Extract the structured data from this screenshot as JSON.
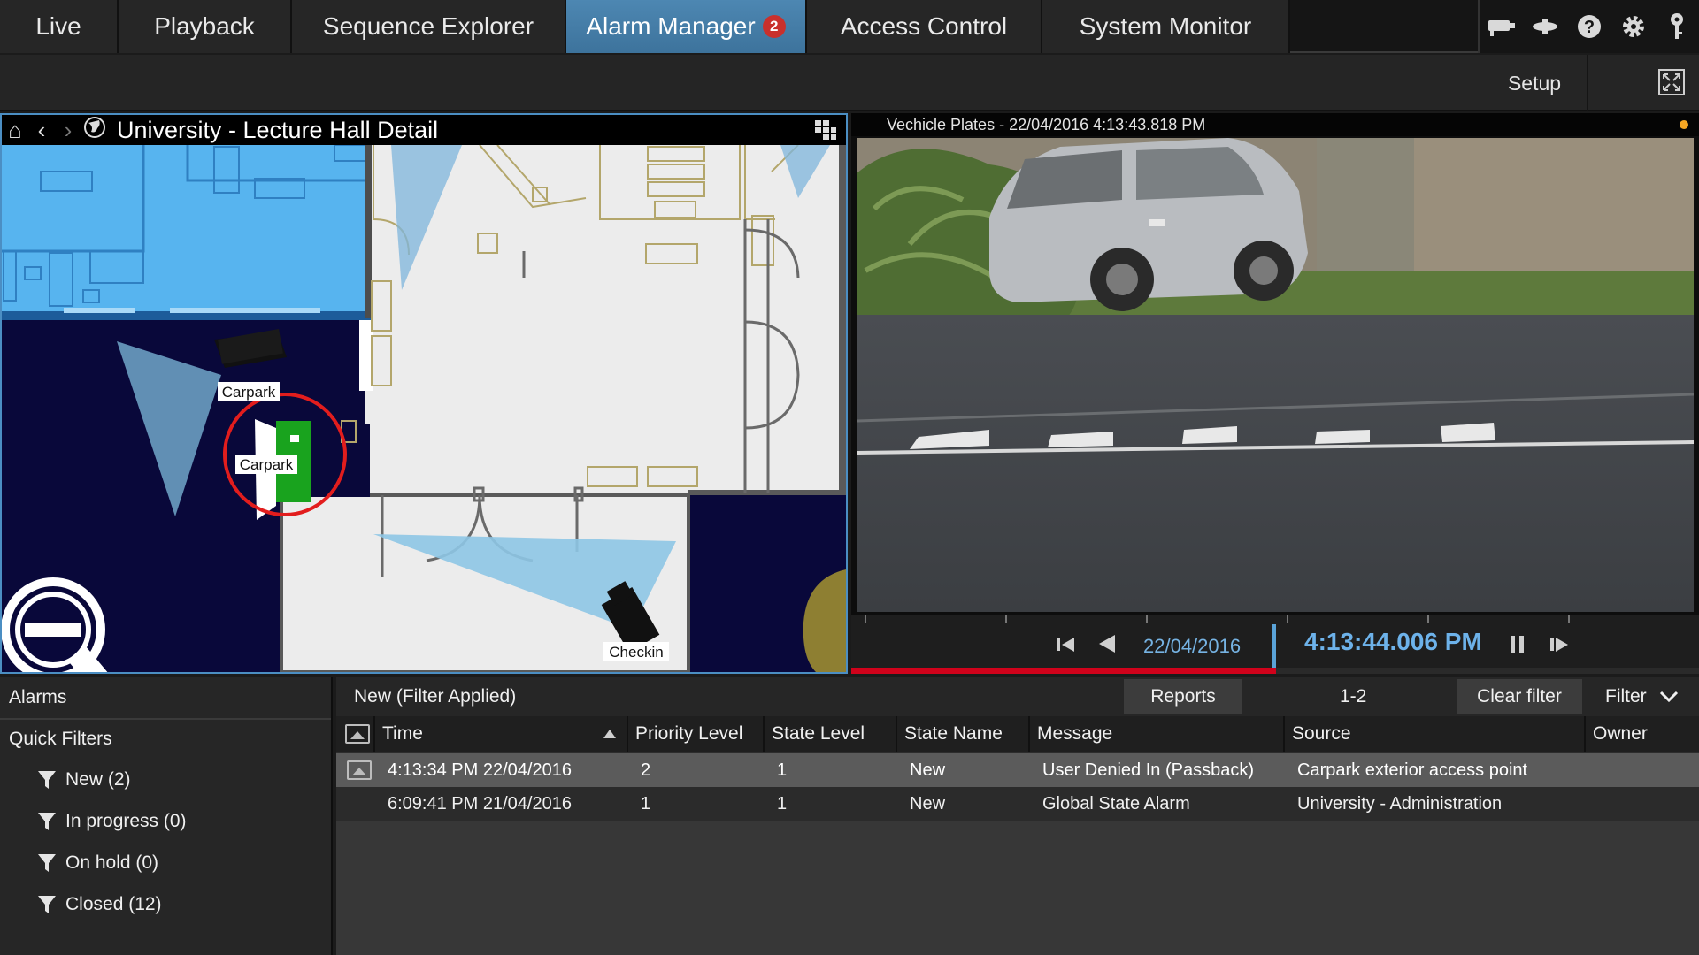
{
  "nav": {
    "tabs": [
      {
        "label": "Live"
      },
      {
        "label": "Playback"
      },
      {
        "label": "Sequence Explorer"
      },
      {
        "label": "Alarm Manager",
        "badge": "2",
        "active": true
      },
      {
        "label": "Access Control"
      },
      {
        "label": "System Monitor"
      }
    ],
    "icons": [
      "camera-icon",
      "device-icon",
      "help-icon",
      "gear-icon",
      "key-icon"
    ]
  },
  "toolbar": {
    "setup_label": "Setup"
  },
  "map": {
    "title": "University - Lecture Hall Detail",
    "labels": {
      "camera_carpark": "Carpark",
      "door_carpark": "Carpark",
      "camera_checkin": "Checkin"
    }
  },
  "video": {
    "title": "Vechicle Plates - 22/04/2016 4:13:43.818 PM",
    "date": "22/04/2016",
    "time": "4:13:44.006 PM",
    "progress": 0.5
  },
  "alarms": {
    "title": "Alarms",
    "quick_filters_title": "Quick Filters",
    "quick_filters": [
      {
        "label": "New (2)"
      },
      {
        "label": "In progress (0)"
      },
      {
        "label": "On hold (0)"
      },
      {
        "label": "Closed (12)"
      }
    ]
  },
  "alarm_list": {
    "status": "New (Filter Applied)",
    "reports_label": "Reports",
    "pager": "1-2",
    "clear_filter_label": "Clear filter",
    "filter_label": "Filter",
    "columns": [
      "Time",
      "Priority Level",
      "State Level",
      "State Name",
      "Message",
      "Source",
      "Owner"
    ],
    "rows": [
      {
        "time": "4:13:34 PM 22/04/2016",
        "priority": "2",
        "state_level": "1",
        "state_name": "New",
        "message": "User Denied In (Passback)",
        "source": "Carpark exterior access point",
        "owner": "",
        "selected": true,
        "has_image": true
      },
      {
        "time": "6:09:41 PM 21/04/2016",
        "priority": "1",
        "state_level": "1",
        "state_name": "New",
        "message": "Global State Alarm",
        "source": "University - Administration",
        "owner": "",
        "selected": false,
        "has_image": false
      }
    ]
  },
  "colors": {
    "accent": "#4d87b2",
    "badge": "#c9302c",
    "time_blue": "#6db2ea",
    "progress_red": "#d0021b",
    "door_green": "#19a31e"
  }
}
